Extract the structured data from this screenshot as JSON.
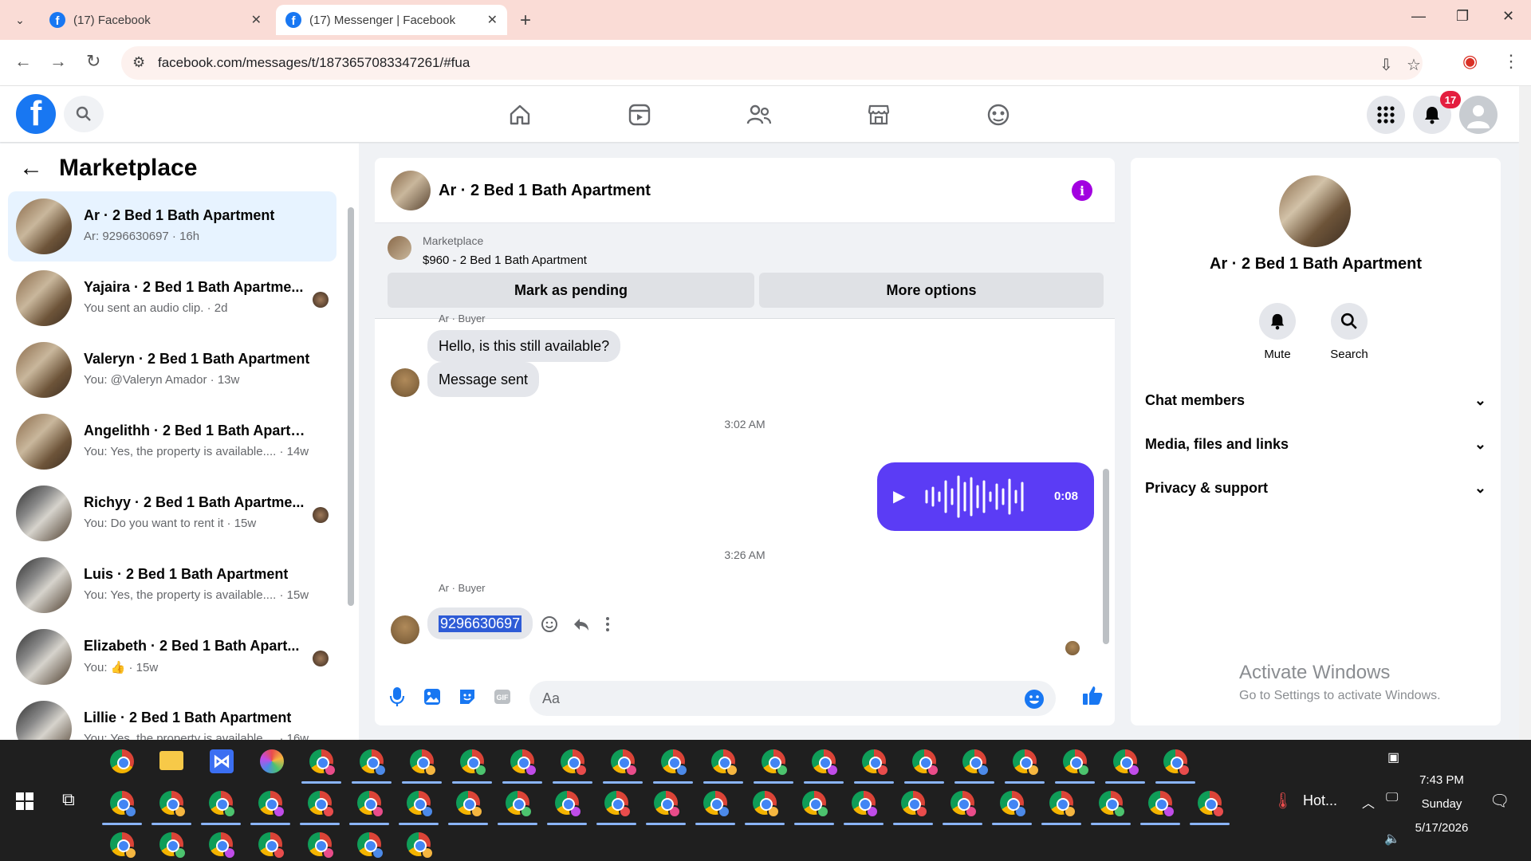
{
  "browser": {
    "tabs": [
      {
        "title": "(17) Facebook",
        "active": false
      },
      {
        "title": "(17) Messenger | Facebook",
        "active": true
      }
    ],
    "url": "facebook.com/messages/t/1873657083347261/#fua"
  },
  "fb": {
    "notification_count": "17"
  },
  "sidebar": {
    "title": "Marketplace",
    "conversations": [
      {
        "name": "Ar · 2 Bed 1 Bath Apartment",
        "snippet": "Ar: 9296630697 · 16h",
        "selected": true
      },
      {
        "name": "Yajaira · 2 Bed 1 Bath Apartme...",
        "snippet": "You sent an audio clip. · 2d"
      },
      {
        "name": "Valeryn · 2 Bed 1 Bath Apartment",
        "snippet": "You: @Valeryn Amador · 13w"
      },
      {
        "name": "Angelithh · 2 Bed 1 Bath Apartm...",
        "snippet": "You: Yes, the property is available.... · 14w"
      },
      {
        "name": "Richyy · 2 Bed 1 Bath Apartme...",
        "snippet": "You: Do you want to rent it · 15w"
      },
      {
        "name": "Luis · 2 Bed 1 Bath Apartment",
        "snippet": "You: Yes, the property is available.... · 15w"
      },
      {
        "name": "Elizabeth · 2 Bed 1 Bath Apart...",
        "snippet": "You: 👍 · 15w"
      },
      {
        "name": "Lillie · 2 Bed 1 Bath Apartment",
        "snippet": "You: Yes, the property is available.... · 16w"
      }
    ]
  },
  "chat": {
    "title": "Ar · 2 Bed 1 Bath Apartment",
    "listing": {
      "label": "Marketplace",
      "price_title": "$960 - 2 Bed 1 Bath Apartment",
      "mark_pending": "Mark as pending",
      "more_options": "More options"
    },
    "sender_label_top": "Ar · Buyer",
    "msg1": "Hello, is this still available?",
    "msg2": "Message sent",
    "time1": "3:02 AM",
    "audio_duration": "0:08",
    "time2": "3:26 AM",
    "sender_label": "Ar · Buyer",
    "phone_msg": "9296630697",
    "composer_placeholder": "Aa"
  },
  "info_panel": {
    "title": "Ar · 2 Bed 1 Bath Apartment",
    "actions": [
      {
        "label": "Mute"
      },
      {
        "label": "Search"
      }
    ],
    "sections": [
      "Chat members",
      "Media, files and links",
      "Privacy & support"
    ],
    "watermark_title": "Activate Windows",
    "watermark_sub": "Go to Settings to activate Windows."
  },
  "taskbar": {
    "weather": "Hot...",
    "time": "7:43 PM",
    "day": "Sunday",
    "date": "5/17/2026"
  },
  "colors": {
    "fb_blue": "#1877f2",
    "audio_bubble": "#5b3cf5",
    "selected_row": "#e7f3ff",
    "badge_red": "#e41e3f"
  }
}
